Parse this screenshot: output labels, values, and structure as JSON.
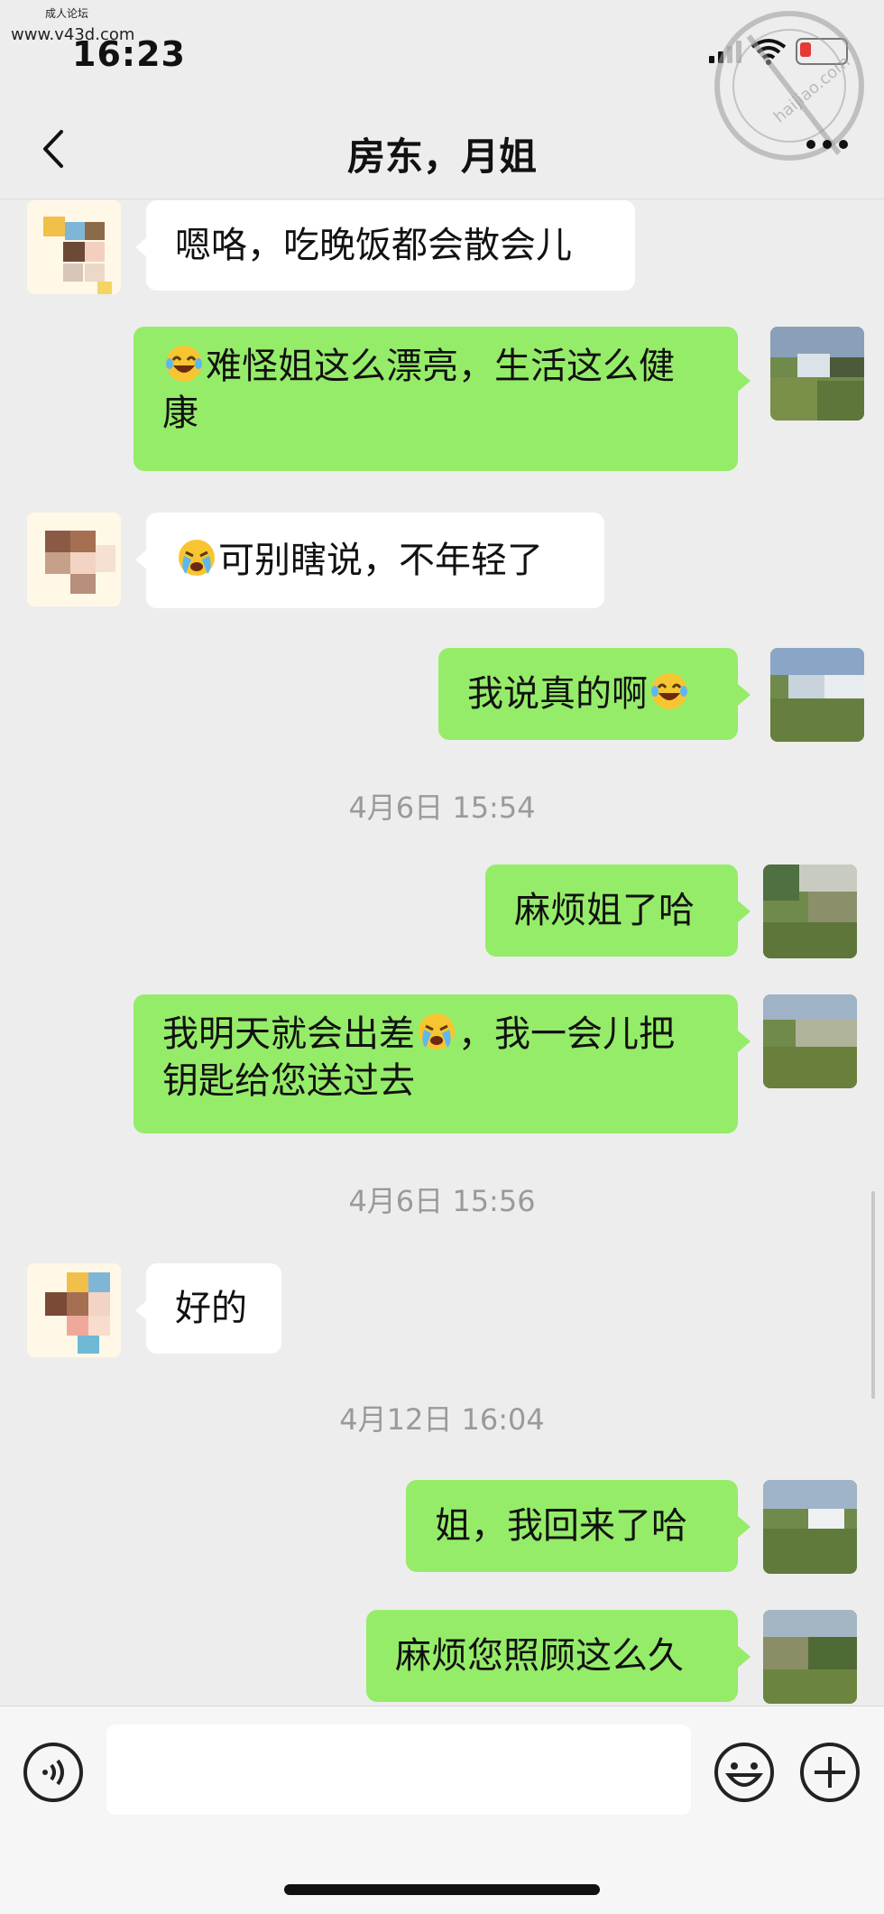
{
  "watermark": {
    "line1": "成人论坛",
    "line2": "www.v43d.com",
    "stamp_text": "haijiao.com"
  },
  "status": {
    "time": "16:23"
  },
  "header": {
    "title": "房东，月姐"
  },
  "timestamps": [
    "4月6日 15:54",
    "4月6日 15:56",
    "4月12日 16:04"
  ],
  "messages": [
    {
      "side": "left",
      "text": "嗯咯，吃晚饭都会散会儿"
    },
    {
      "side": "right",
      "emoji": "laughing-tears",
      "text": "难怪姐这么漂亮，生活这么健\n康"
    },
    {
      "side": "left",
      "emoji": "crying",
      "text": "可别瞎说，不年轻了"
    },
    {
      "side": "right",
      "text": "我说真的啊",
      "emoji_after": "laughing-tears"
    },
    {
      "side": "right",
      "text": "麻烦姐了哈"
    },
    {
      "side": "right",
      "text_a": "我明天就会出差",
      "emoji": "crying",
      "text_b": "，我一会儿把\n钥匙给您送过去"
    },
    {
      "side": "left",
      "text": "好的"
    },
    {
      "side": "right",
      "text": "姐，我回来了哈"
    },
    {
      "side": "right",
      "text": "麻烦您照顾这么久"
    }
  ],
  "input": {
    "placeholder": ""
  },
  "icons": {
    "voice": "voice-icon",
    "emoji": "emoji-icon",
    "plus": "plus-icon",
    "back": "back-chevron-icon",
    "more": "more-icon"
  },
  "colors": {
    "bubble_self": "#95ec69",
    "bubble_other": "#ffffff",
    "background": "#ededed"
  }
}
